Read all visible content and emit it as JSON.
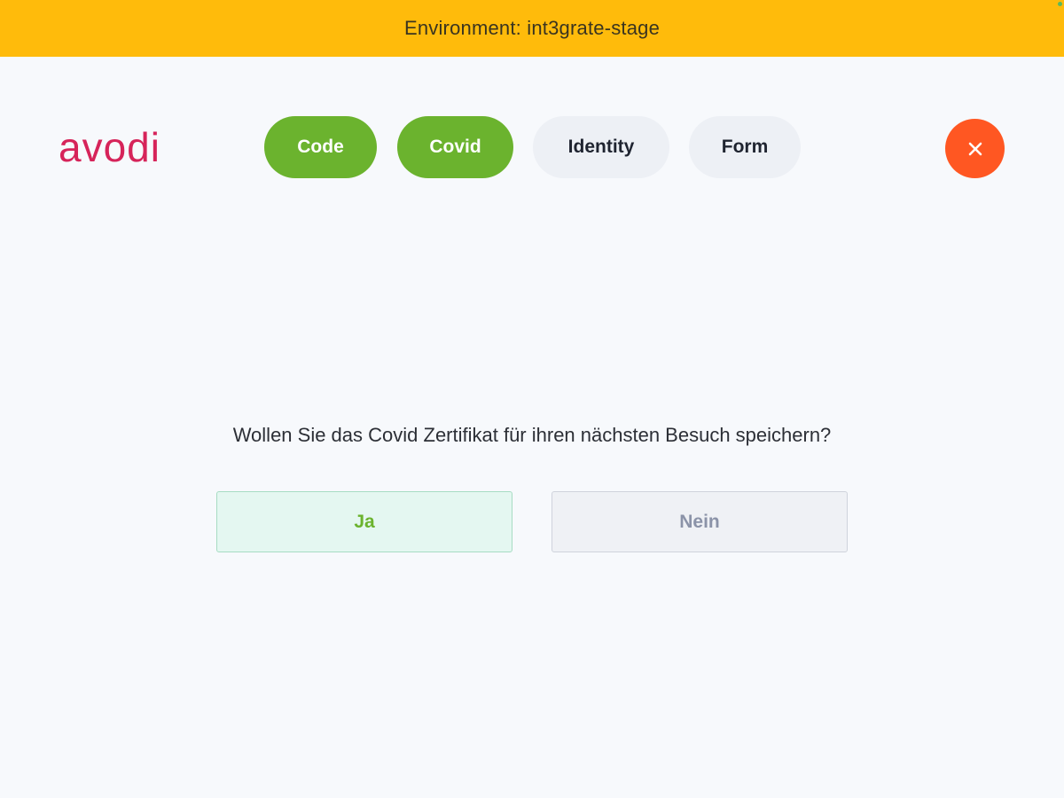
{
  "environment_banner": {
    "text": "Environment: int3grate-stage",
    "color": "#ffbb0b"
  },
  "header": {
    "logo_text": "avodi",
    "logo_color": "#d6245a",
    "steps": [
      {
        "label": "Code",
        "state": "completed"
      },
      {
        "label": "Covid",
        "state": "completed"
      },
      {
        "label": "Identity",
        "state": "pending"
      },
      {
        "label": "Form",
        "state": "pending"
      }
    ],
    "close_icon": "close-icon",
    "close_color": "#ff5722",
    "completed_color": "#6bb32e"
  },
  "main": {
    "question": "Wollen Sie das Covid Zertifikat für ihren nächsten Besuch speichern?",
    "yes_label": "Ja",
    "no_label": "Nein"
  }
}
